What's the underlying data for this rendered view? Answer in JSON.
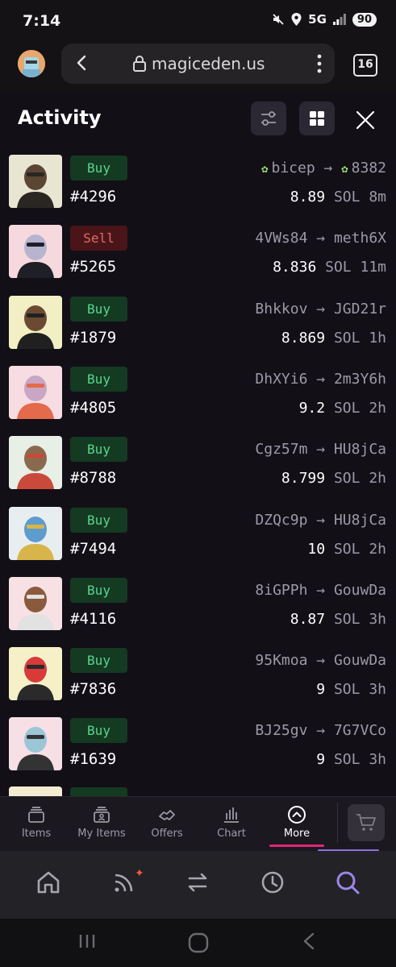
{
  "status": {
    "time": "7:14",
    "network": "5G",
    "battery": "90"
  },
  "browser": {
    "url": "magiceden.us",
    "tab_count": "16"
  },
  "panel": {
    "title": "Activity"
  },
  "activity": [
    {
      "side": "Buy",
      "token": "#4296",
      "from": "bicep",
      "to": "8382",
      "from_verified": true,
      "to_verified": true,
      "price": "8.89",
      "unit": "SOL",
      "time": "8m",
      "colors": [
        "#e9e5d3",
        "#5b4634",
        "#2a2622"
      ]
    },
    {
      "side": "Sell",
      "token": "#5265",
      "from": "4VWs84",
      "to": "meth6X",
      "price": "8.836",
      "unit": "SOL",
      "time": "11m",
      "colors": [
        "#f6d9df",
        "#b7b4cf",
        "#1f1f26"
      ]
    },
    {
      "side": "Buy",
      "token": "#1879",
      "from": "Bhkkov",
      "to": "JGD21r",
      "price": "8.869",
      "unit": "SOL",
      "time": "1h",
      "colors": [
        "#f3efc4",
        "#6b4a33",
        "#202020"
      ]
    },
    {
      "side": "Buy",
      "token": "#4805",
      "from": "DhXYi6",
      "to": "2m3Y6h",
      "price": "9.2",
      "unit": "SOL",
      "time": "2h",
      "colors": [
        "#f7dde3",
        "#c9a6c4",
        "#e36a4a"
      ]
    },
    {
      "side": "Buy",
      "token": "#8788",
      "from": "Cgz57m",
      "to": "HU8jCa",
      "price": "8.799",
      "unit": "SOL",
      "time": "2h",
      "colors": [
        "#e7efe6",
        "#8a6a4f",
        "#c94a3a"
      ]
    },
    {
      "side": "Buy",
      "token": "#7494",
      "from": "DZQc9p",
      "to": "HU8jCa",
      "price": "10",
      "unit": "SOL",
      "time": "2h",
      "colors": [
        "#e8eef0",
        "#5d9ccd",
        "#d8b54a"
      ]
    },
    {
      "side": "Buy",
      "token": "#4116",
      "from": "8iGPPh",
      "to": "GouwDa",
      "price": "8.87",
      "unit": "SOL",
      "time": "3h",
      "colors": [
        "#f8e1e4",
        "#8a5a3c",
        "#e2e2e2"
      ]
    },
    {
      "side": "Buy",
      "token": "#7836",
      "from": "95Kmoa",
      "to": "GouwDa",
      "price": "9",
      "unit": "SOL",
      "time": "3h",
      "colors": [
        "#f5f0c8",
        "#d83a3a",
        "#2a2a2a"
      ]
    },
    {
      "side": "Buy",
      "token": "#1639",
      "from": "BJ25gv",
      "to": "7G7VCo",
      "price": "9",
      "unit": "SOL",
      "time": "3h",
      "colors": [
        "#f7dfe6",
        "#9ac6d8",
        "#333333"
      ]
    }
  ],
  "site_tabs": [
    {
      "label": "Items",
      "icon": "stack-icon"
    },
    {
      "label": "My Items",
      "icon": "user-stack-icon"
    },
    {
      "label": "Offers",
      "icon": "handshake-icon"
    },
    {
      "label": "Chart",
      "icon": "bar-chart-icon"
    },
    {
      "label": "More",
      "icon": "chevron-up-circle-icon",
      "active": true
    }
  ],
  "app_nav": [
    "home-icon",
    "feed-icon",
    "swap-icon",
    "history-icon",
    "search-icon"
  ],
  "colors": {
    "buy_bg": "#143a22",
    "buy_text": "#58d68d",
    "sell_bg": "#4a1518",
    "sell_text": "#e26a6a",
    "accent": "#e42575",
    "app_accent": "#8a6fe0"
  }
}
